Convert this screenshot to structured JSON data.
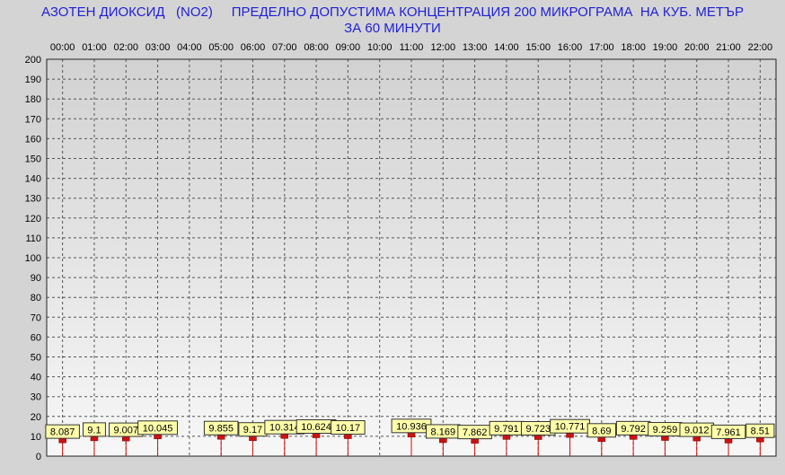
{
  "chart_data": {
    "type": "bar",
    "title": "АЗОТЕН ДИОКСИД   (NO2)     ПРЕДЕЛНО ДОПУСТИМА КОНЦЕНТРАЦИЯ 200 МИКРОГРАМА  НА КУБ. МЕТЪР",
    "subtitle": "ЗА 60 МИНУТИ",
    "xlabel": "",
    "ylabel": "",
    "ylim": [
      0,
      200
    ],
    "y_ticks": [
      0,
      10,
      20,
      30,
      40,
      50,
      60,
      70,
      80,
      90,
      100,
      110,
      120,
      130,
      140,
      150,
      160,
      170,
      180,
      190,
      200
    ],
    "x_axis_position": "top",
    "grid": true,
    "categories": [
      "00:00",
      "01:00",
      "02:00",
      "03:00",
      "04:00",
      "05:00",
      "06:00",
      "07:00",
      "08:00",
      "09:00",
      "10:00",
      "11:00",
      "12:00",
      "13:00",
      "14:00",
      "15:00",
      "16:00",
      "17:00",
      "18:00",
      "19:00",
      "20:00",
      "21:00",
      "22:00"
    ],
    "values": [
      8.087,
      9.1,
      9.007,
      10.045,
      null,
      9.855,
      9.17,
      10.314,
      10.624,
      10.17,
      null,
      10.936,
      8.169,
      7.862,
      9.791,
      9.723,
      10.771,
      8.69,
      9.792,
      9.259,
      9.012,
      7.961,
      8.51
    ],
    "data_labels": [
      "8.087",
      "9.1",
      "9.007",
      "10.045",
      "",
      "9.855",
      "9.17",
      "10.314",
      "10.624",
      "10.17",
      "",
      "10.936",
      "8.169",
      "7.862",
      "9.791",
      "9.723",
      "10.771",
      "8.69",
      "9.792",
      "9.259",
      "9.012",
      "7.961",
      "8.51"
    ],
    "colors": {
      "background": "#d4d4d4",
      "plot_top": "#d2d2d2",
      "plot_bottom": "#f7f7f7",
      "bar": "#cc1111",
      "label_bg": "#ffffaa",
      "title": "#1f1fd6"
    }
  }
}
